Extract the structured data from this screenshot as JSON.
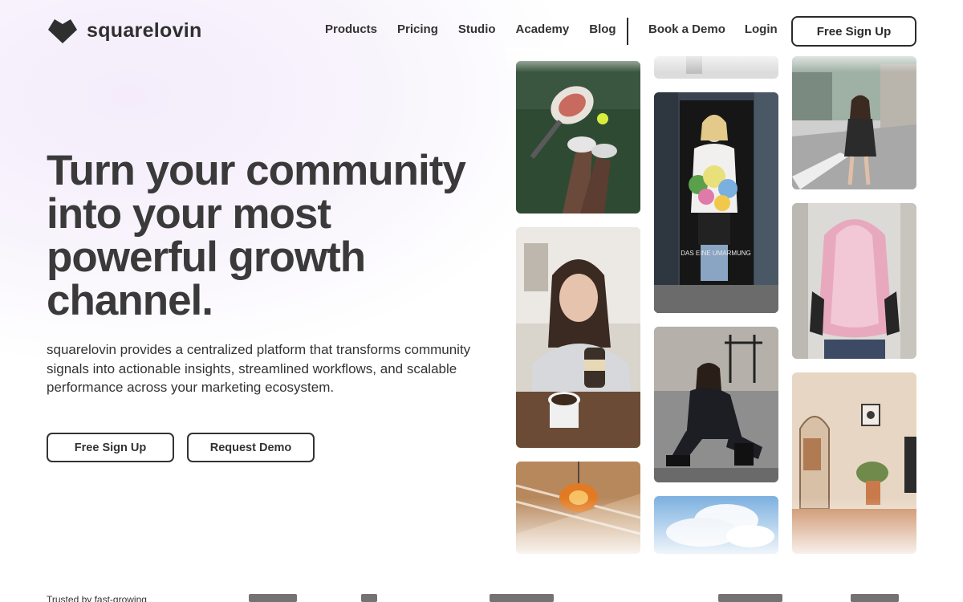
{
  "brand": {
    "name": "squarelovin"
  },
  "nav": {
    "links": [
      "Products",
      "Pricing",
      "Studio",
      "Academy",
      "Blog"
    ],
    "right_links": [
      "Book a Demo",
      "Login"
    ],
    "cta_label": "Free Sign Up"
  },
  "hero": {
    "title": "Turn your community into your most powerful growth channel.",
    "subtitle": "squarelovin provides a centralized platform that transforms community signals into actionable insights, streamlined workflows, and scalable performance across your marketing ecosystem.",
    "primary_button": "Free Sign Up",
    "secondary_button": "Request Demo"
  },
  "trusted": {
    "label": "Trusted by fast-growing"
  },
  "gallery": {
    "images": [
      "padel-racket-sneakers-photo",
      "woman-eating-yogurt-photo",
      "pendant-lamp-staircase-photo",
      "woman-with-flowers-doorway-photo",
      "woman-sitting-on-curb-photo",
      "sky-clouds-photo",
      "woman-street-palm-trees-photo",
      "pink-hair-back-view-photo",
      "interior-arched-mirror-photo"
    ],
    "flower_caption": "DAS EINE UMARMUNG"
  },
  "colors": {
    "text": "#2b2b2b",
    "accent_bg": "#f4ecfb",
    "button_border": "#333333"
  }
}
